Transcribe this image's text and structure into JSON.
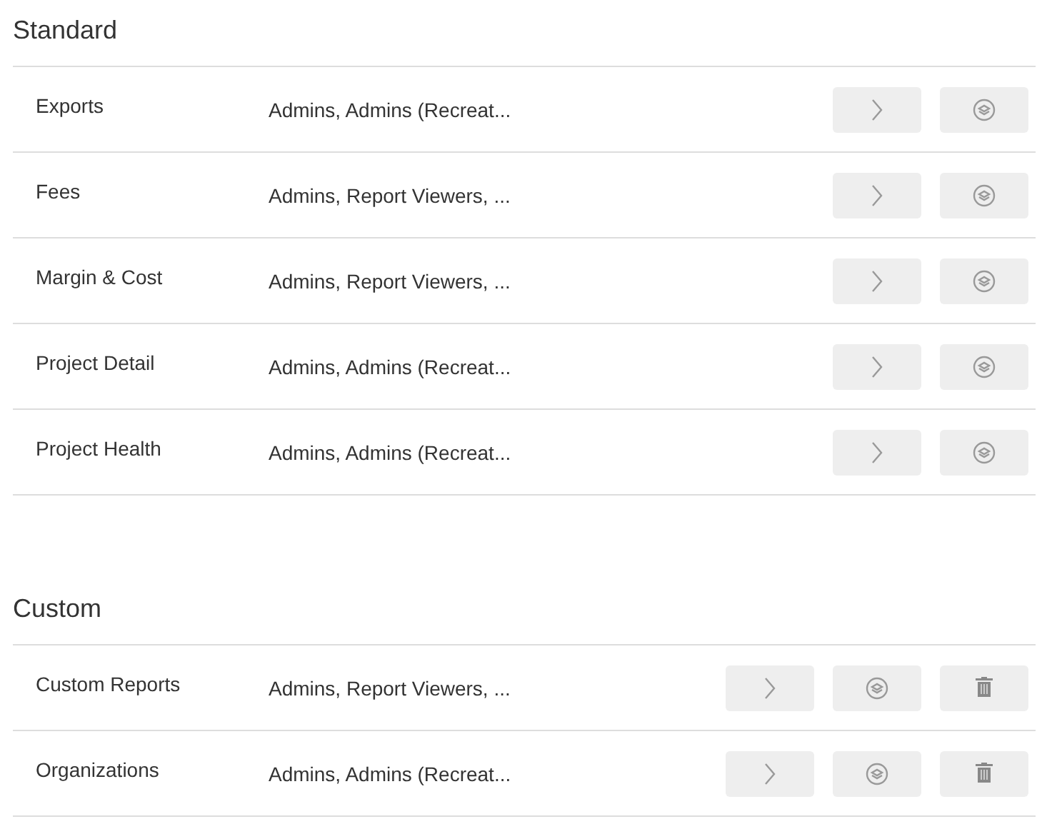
{
  "sections": [
    {
      "title": "Standard",
      "rows": [
        {
          "name": "Exports",
          "roles": "Admins, Admins (Recreat...",
          "actions": [
            {
              "kind": "open"
            },
            {
              "kind": "layers"
            }
          ]
        },
        {
          "name": "Fees",
          "roles": "Admins, Report Viewers, ...",
          "actions": [
            {
              "kind": "open"
            },
            {
              "kind": "layers"
            }
          ]
        },
        {
          "name": "Margin & Cost",
          "roles": "Admins, Report Viewers, ...",
          "actions": [
            {
              "kind": "open"
            },
            {
              "kind": "layers"
            }
          ]
        },
        {
          "name": "Project Detail",
          "roles": "Admins, Admins (Recreat...",
          "actions": [
            {
              "kind": "open"
            },
            {
              "kind": "layers"
            }
          ]
        },
        {
          "name": "Project Health",
          "roles": "Admins, Admins (Recreat...",
          "actions": [
            {
              "kind": "open"
            },
            {
              "kind": "layers"
            }
          ]
        }
      ]
    },
    {
      "title": "Custom",
      "rows": [
        {
          "name": "Custom Reports",
          "roles": "Admins, Report Viewers, ...",
          "actions": [
            {
              "kind": "open"
            },
            {
              "kind": "layers"
            },
            {
              "kind": "delete"
            }
          ]
        },
        {
          "name": "Organizations",
          "roles": "Admins, Admins (Recreat...",
          "actions": [
            {
              "kind": "open"
            },
            {
              "kind": "layers"
            },
            {
              "kind": "delete"
            }
          ]
        }
      ]
    }
  ]
}
